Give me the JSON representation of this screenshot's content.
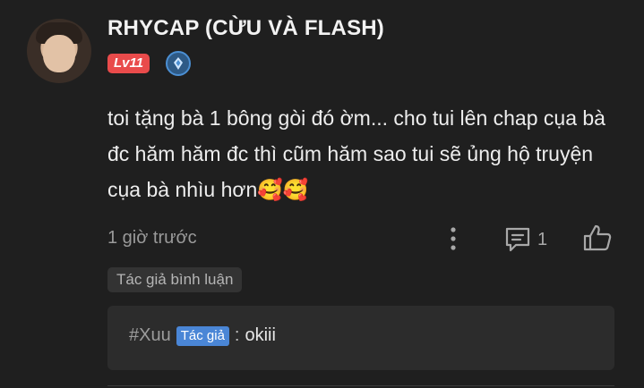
{
  "user": {
    "name": "RHYCAP (CỪU VÀ FLASH)",
    "level": "Lv11"
  },
  "comment": {
    "text": "toi tặng bà 1 bông gòi đó ờm... cho tui lên chap cụa bà đc hăm hăm đc thì cũm hăm sao tui sẽ ủng hộ truyện cụa bà nhìu hơn",
    "emoji": "🥰🥰",
    "time": "1 giờ trước",
    "reply_count": "1",
    "author_tag": "Tác giả bình luận"
  },
  "reply": {
    "author": "#Xuu",
    "badge": "Tác giả",
    "separator": ":",
    "text": "okiii"
  },
  "colors": {
    "background": "#1f1f1f",
    "level_badge": "#e94b4b",
    "author_badge": "#4a86d6"
  },
  "icons": {
    "rank": "rank-shield-icon",
    "more": "more-vertical-icon",
    "reply": "comment-icon",
    "like": "thumbs-up-icon"
  }
}
